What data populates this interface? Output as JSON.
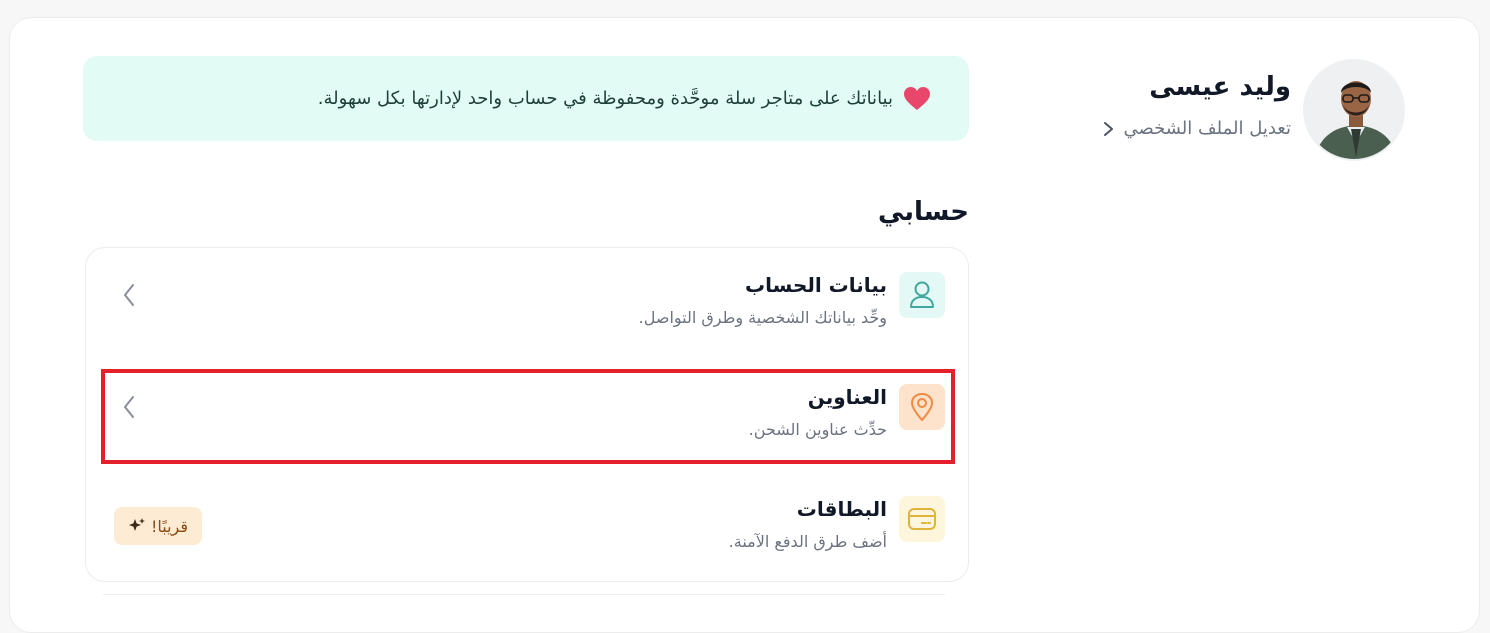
{
  "profile": {
    "name": "وليد عيسى",
    "edit_link": "تعديل الملف الشخصي"
  },
  "banner": {
    "text": "بياناتك على متاجر سلة موحَّدة ومحفوظة في حساب واحد لإدارتها بكل سهولة."
  },
  "section": {
    "title": "حسابي"
  },
  "menu": {
    "items": [
      {
        "title": "بيانات الحساب",
        "description": "وحِّد بياناتك الشخصية وطرق التواصل.",
        "icon": "user-icon",
        "highlighted": false
      },
      {
        "title": "العناوين",
        "description": "حدِّث عناوين الشحن.",
        "icon": "location-pin-icon",
        "highlighted": true
      },
      {
        "title": "البطاقات",
        "description": "أضف طرق الدفع الآمنة.",
        "icon": "credit-card-icon",
        "badge": "قريبًا!",
        "highlighted": false
      }
    ]
  },
  "colors": {
    "banner_bg": "#e2fbf5",
    "heart": "#e8466a",
    "highlight_border": "#e3202b",
    "account_icon": "#3fa79d",
    "addresses_icon": "#f08a43",
    "cards_icon": "#e0b43a",
    "badge_bg": "#fdebd3"
  }
}
